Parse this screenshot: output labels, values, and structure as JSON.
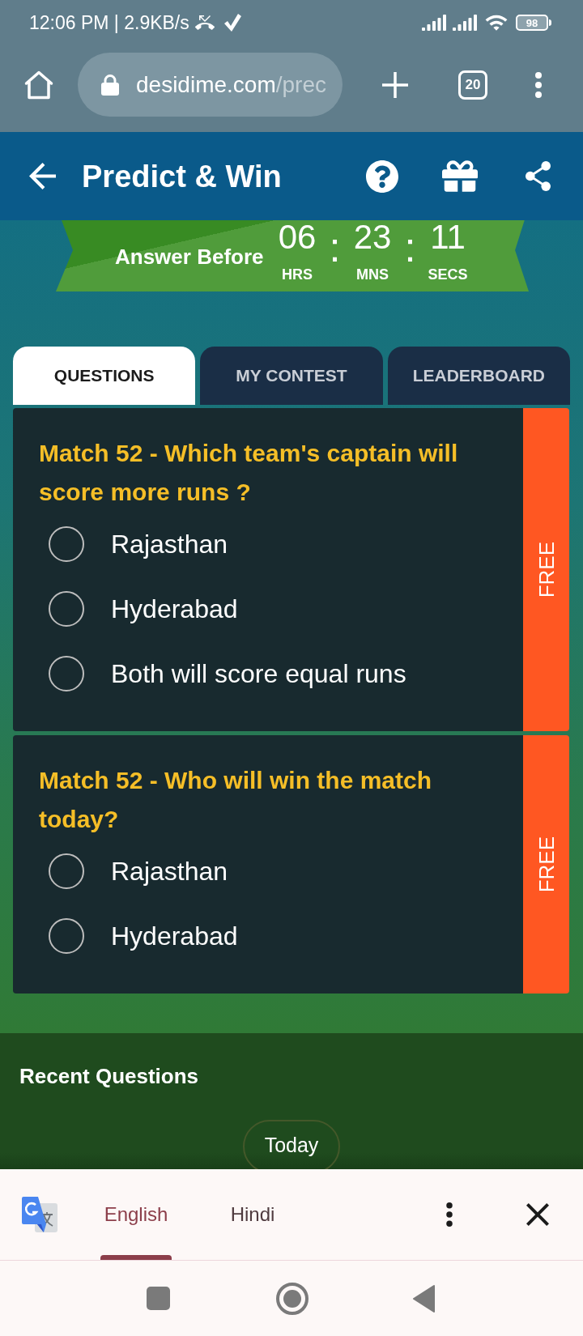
{
  "status_bar": {
    "text": "12:06 PM | 2.9KB/s",
    "battery": "98"
  },
  "browser": {
    "url_domain": "desidime.com",
    "url_path": "/prec",
    "tab_count": "20"
  },
  "header": {
    "title": "Predict & Win"
  },
  "countdown": {
    "label": "Answer Before",
    "units": [
      {
        "value": "06",
        "unit": "HRS"
      },
      {
        "value": "23",
        "unit": "MNS"
      },
      {
        "value": "11",
        "unit": "SECS"
      }
    ],
    "separators": [
      ":",
      ":"
    ]
  },
  "tabs": [
    {
      "label": "QUESTIONS",
      "selected": true
    },
    {
      "label": "MY CONTEST",
      "selected": false
    },
    {
      "label": "LEADERBOARD",
      "selected": false
    }
  ],
  "questions": [
    {
      "title": "Match 52 - Which team's captain will score more runs ?",
      "tag": "FREE",
      "options": [
        {
          "label": "Rajasthan",
          "selected": false
        },
        {
          "label": "Hyderabad",
          "selected": false
        },
        {
          "label": "Both will score equal runs",
          "selected": false
        }
      ]
    },
    {
      "title": "Match 52 - Who will win the match today?",
      "tag": "FREE",
      "options": [
        {
          "label": "Rajasthan",
          "selected": false
        },
        {
          "label": "Hyderabad",
          "selected": false
        }
      ]
    }
  ],
  "recent_questions": {
    "title": "Recent Questions",
    "filter_chip": "Today"
  },
  "translate_bar": {
    "languages": [
      {
        "label": "English",
        "selected": true
      },
      {
        "label": "Hindi",
        "selected": false
      }
    ]
  }
}
